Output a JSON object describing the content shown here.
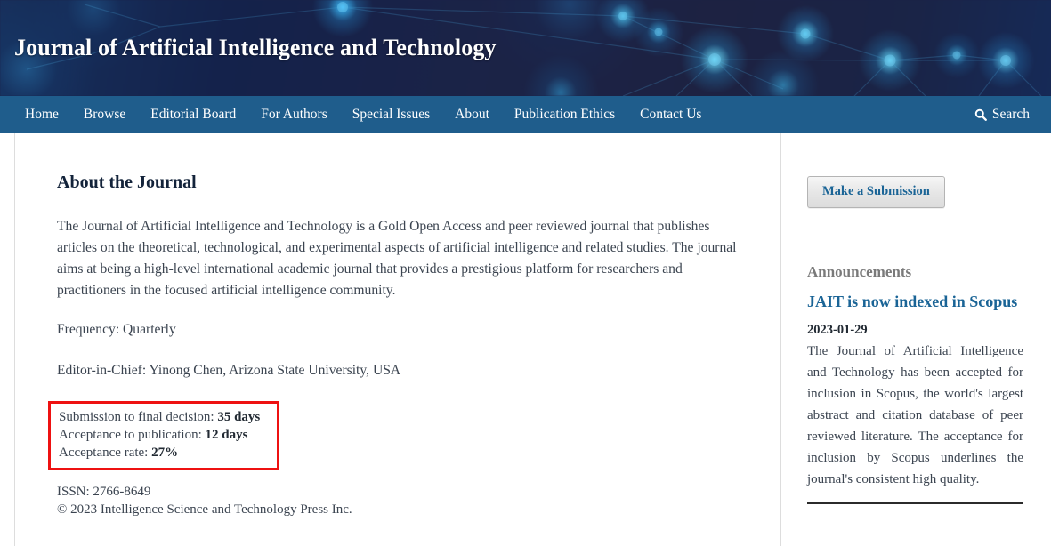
{
  "site": {
    "title": "Journal of Artificial Intelligence and Technology",
    "accent_blue": "#1f5d8c",
    "link_blue": "#1a6496",
    "highlight_red": "#ee1111",
    "header_bg": "#1b2246"
  },
  "nav": {
    "items": [
      {
        "label": "Home"
      },
      {
        "label": "Browse"
      },
      {
        "label": "Editorial Board"
      },
      {
        "label": "For Authors"
      },
      {
        "label": "Special Issues"
      },
      {
        "label": "About"
      },
      {
        "label": "Publication Ethics"
      },
      {
        "label": "Contact Us"
      }
    ],
    "search_label": "Search",
    "search_icon": "search-icon"
  },
  "main": {
    "heading": "About the Journal",
    "intro": "The Journal of Artificial Intelligence and Technology is a Gold Open Access and peer reviewed journal that publishes articles on the theoretical, technological, and experimental aspects of artificial intelligence and related studies. The journal aims at being a high-level international academic journal that provides a prestigious platform for researchers and practitioners in the focused artificial intelligence community.",
    "frequency": "Frequency: Quarterly",
    "editor_in_chief": "Editor-in-Chief: Yinong Chen, Arizona State University, USA",
    "stats": [
      {
        "label": "Submission to final decision:",
        "value": "35 days"
      },
      {
        "label": "Acceptance to publication:",
        "value": "12 days"
      },
      {
        "label": "Acceptance rate:",
        "value": "27%"
      }
    ],
    "issn": "ISSN: 2766-8649",
    "copyright": "© 2023 Intelligence Science and Technology Press Inc."
  },
  "sidebar": {
    "submission_button": "Make a Submission",
    "announcements_heading": "Announcements",
    "announcement": {
      "title": "JAIT is now indexed in Scopus",
      "date": "2023-01-29",
      "body": "The Journal of Artificial Intelligence and Technology has been accepted for inclusion in Scopus, the world's largest abstract and citation database of peer reviewed literature. The acceptance for inclusion by Scopus underlines the journal's consistent high quality."
    }
  }
}
